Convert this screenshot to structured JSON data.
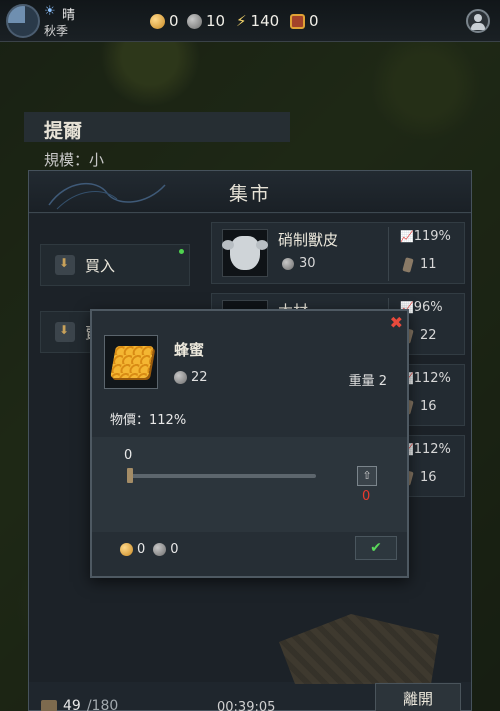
{
  "hud": {
    "weather": "晴",
    "season": "秋季",
    "resources": [
      {
        "name": "gold-coin",
        "value": "0"
      },
      {
        "name": "silver-coin",
        "value": "10"
      },
      {
        "name": "energy",
        "value": "140"
      },
      {
        "name": "honey-item",
        "value": "0"
      }
    ]
  },
  "village": {
    "name": "提爾",
    "scale": "規模：小"
  },
  "market": {
    "title": "集市",
    "tabs": [
      {
        "label": "買入"
      },
      {
        "label": "賣"
      }
    ],
    "items": [
      {
        "name": "硝制獸皮",
        "price": "30",
        "trend": "119%",
        "stock": "11"
      },
      {
        "name": "木材",
        "price": "",
        "trend": "96%",
        "stock": "22"
      },
      {
        "name": "",
        "price": "",
        "trend": "112%",
        "stock": "16"
      },
      {
        "name": "",
        "price": "",
        "trend": "112%",
        "stock": "16"
      }
    ],
    "capacity": {
      "current": "49",
      "max": "/180"
    },
    "timer": "00:39:05",
    "leave_label": "離開"
  },
  "dialog": {
    "item_name": "蜂蜜",
    "price": "22",
    "weight": "重量 2",
    "price_level": "物價：112%",
    "quantity": "0",
    "quantity_fraction": 0,
    "cost": "0",
    "totals": {
      "gold": "0",
      "silver": "0"
    },
    "close_symbol": "✖",
    "confirm_symbol": "✔",
    "max_symbol": "⇧"
  },
  "colors": {
    "accent_red": "#ea3a2e",
    "confirm_green": "#5ad85a",
    "coin_gold": "#e0a235"
  }
}
